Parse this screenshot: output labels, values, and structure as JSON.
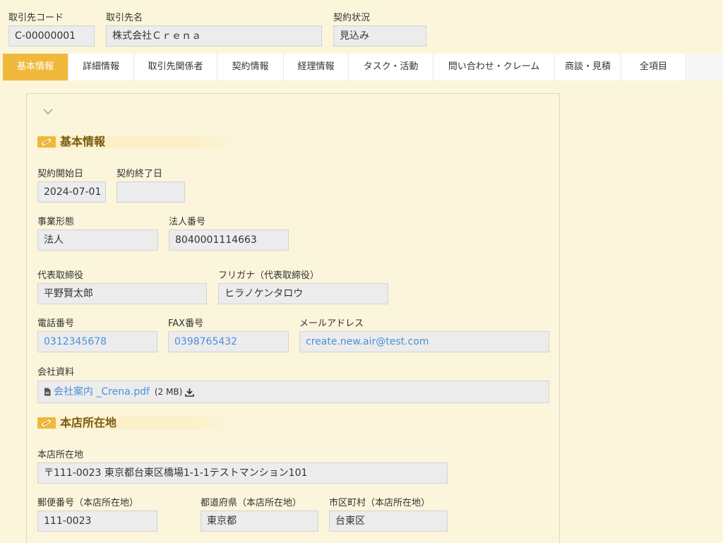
{
  "header": {
    "code_label": "取引先コード",
    "code_value": "C-00000001",
    "name_label": "取引先名",
    "name_value": "株式会社Ｃｒｅｎａ",
    "status_label": "契約状況",
    "status_value": "見込み"
  },
  "tabs": [
    {
      "label": "基本情報",
      "active": true
    },
    {
      "label": "詳細情報",
      "active": false
    },
    {
      "label": "取引先関係者",
      "active": false
    },
    {
      "label": "契約情報",
      "active": false
    },
    {
      "label": "経理情報",
      "active": false
    },
    {
      "label": "タスク・活動",
      "active": false
    },
    {
      "label": "問い合わせ・クレーム",
      "active": false
    },
    {
      "label": "商談・見積",
      "active": false
    },
    {
      "label": "全項目",
      "active": false
    }
  ],
  "basic": {
    "title": "基本情報",
    "contract_start_label": "契約開始日",
    "contract_start_value": "2024-07-01",
    "contract_end_label": "契約終了日",
    "contract_end_value": "",
    "business_type_label": "事業形態",
    "business_type_value": "法人",
    "corp_number_label": "法人番号",
    "corp_number_value": "8040001114663",
    "rep_label": "代表取締役",
    "rep_value": "平野賢太郎",
    "rep_kana_label": "フリガナ（代表取締役）",
    "rep_kana_value": "ヒラノケンタロウ",
    "phone_label": "電話番号",
    "phone_value": "0312345678",
    "fax_label": "FAX番号",
    "fax_value": "0398765432",
    "email_label": "メールアドレス",
    "email_value": "create.new.air@test.com",
    "docs_label": "会社資料",
    "doc_name": "会社案内 _Crena.pdf",
    "doc_size": "(2 MB)"
  },
  "address": {
    "title": "本店所在地",
    "hq_label": "本店所在地",
    "hq_value": "〒111-0023 東京都台東区橋場1-1-1テストマンション101",
    "zip_label": "郵便番号（本店所在地）",
    "zip_value": "111-0023",
    "pref_label": "都道府県（本店所在地）",
    "pref_value": "東京都",
    "city_label": "市区町村（本店所在地）",
    "city_value": "台東区"
  },
  "colors": {
    "accent": "#f0b93b",
    "background": "#fbf5db",
    "link": "#4a90d9",
    "section_title": "#7a5a12"
  }
}
